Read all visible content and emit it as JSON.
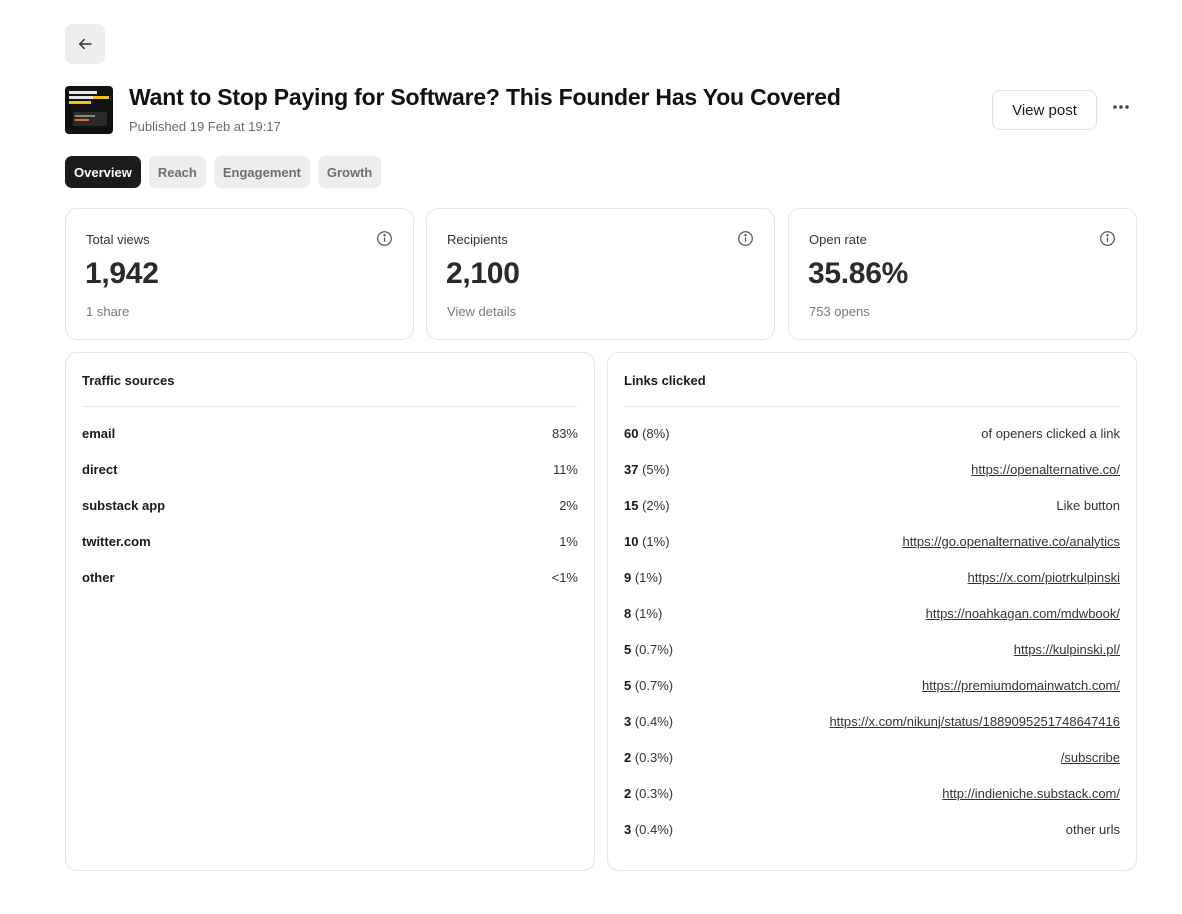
{
  "header": {
    "title": "Want to Stop Paying for Software? This Founder Has You Covered",
    "published": "Published 19 Feb at 19:17",
    "view_post_label": "View post"
  },
  "icons": {
    "back": "arrow-left-icon",
    "more": "more-horizontal-icon",
    "info": "info-circle-icon"
  },
  "tabs": [
    {
      "label": "Overview",
      "active": true
    },
    {
      "label": "Reach",
      "active": false
    },
    {
      "label": "Engagement",
      "active": false
    },
    {
      "label": "Growth",
      "active": false
    }
  ],
  "stats": [
    {
      "label": "Total views",
      "value": "1,942",
      "sub": "1 share"
    },
    {
      "label": "Recipients",
      "value": "2,100",
      "sub": "View details"
    },
    {
      "label": "Open rate",
      "value": "35.86%",
      "sub": "753 opens"
    }
  ],
  "traffic_sources": {
    "title": "Traffic sources",
    "rows": [
      {
        "name": "email",
        "value": "83%"
      },
      {
        "name": "direct",
        "value": "11%"
      },
      {
        "name": "substack app",
        "value": "2%"
      },
      {
        "name": "twitter.com",
        "value": "1%"
      },
      {
        "name": "other",
        "value": "<1%"
      }
    ]
  },
  "links_clicked": {
    "title": "Links clicked",
    "rows": [
      {
        "count": "60",
        "pct": " (8%)",
        "target": "of openers clicked a link",
        "is_url": false
      },
      {
        "count": "37",
        "pct": " (5%)",
        "target": "https://openalternative.co/",
        "is_url": true
      },
      {
        "count": "15",
        "pct": " (2%)",
        "target": "Like button",
        "is_url": false
      },
      {
        "count": "10",
        "pct": " (1%)",
        "target": "https://go.openalternative.co/analytics",
        "is_url": true
      },
      {
        "count": "9",
        "pct": " (1%)",
        "target": "https://x.com/piotrkulpinski",
        "is_url": true
      },
      {
        "count": "8",
        "pct": " (1%)",
        "target": "https://noahkagan.com/mdwbook/",
        "is_url": true
      },
      {
        "count": "5",
        "pct": " (0.7%)",
        "target": "https://kulpinski.pl/",
        "is_url": true
      },
      {
        "count": "5",
        "pct": " (0.7%)",
        "target": "https://premiumdomainwatch.com/",
        "is_url": true
      },
      {
        "count": "3",
        "pct": " (0.4%)",
        "target": "https://x.com/nikunj/status/1889095251748647416",
        "is_url": true
      },
      {
        "count": "2",
        "pct": " (0.3%)",
        "target": "/subscribe",
        "is_url": true
      },
      {
        "count": "2",
        "pct": " (0.3%)",
        "target": "http://indieniche.substack.com/",
        "is_url": true
      },
      {
        "count": "3",
        "pct": " (0.4%)",
        "target": "other urls",
        "is_url": false
      }
    ]
  }
}
